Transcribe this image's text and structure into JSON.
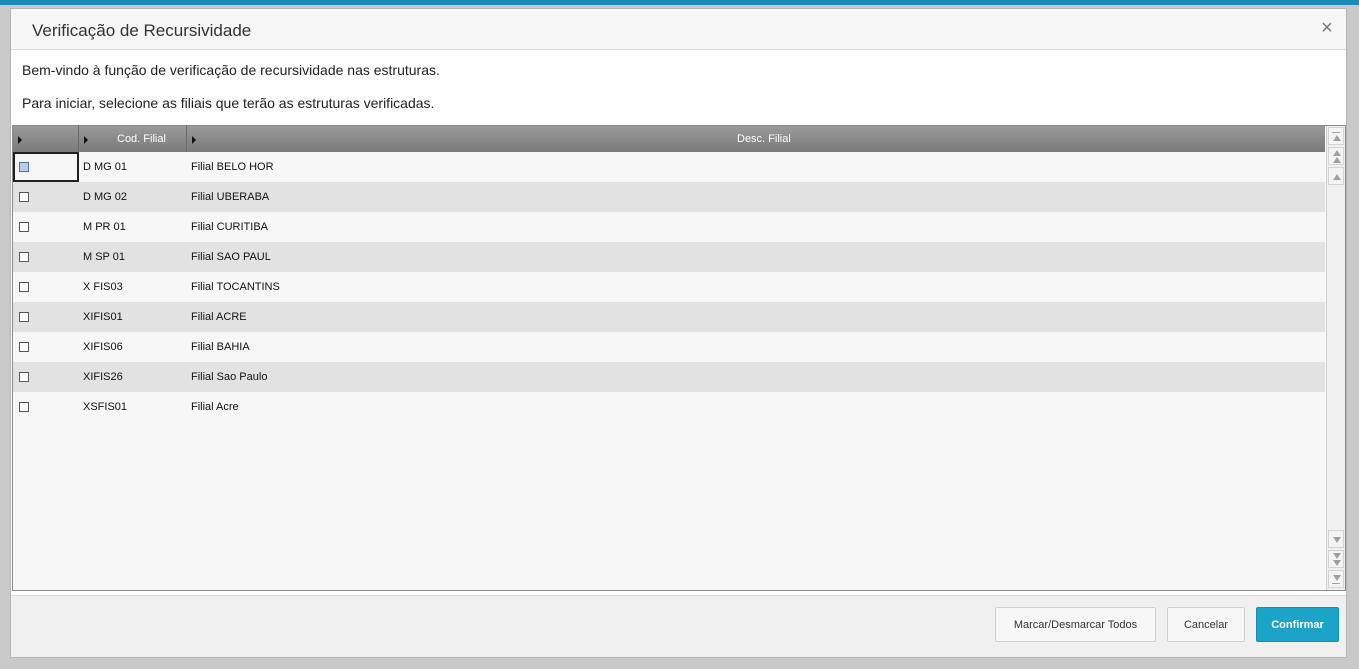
{
  "dialog": {
    "title": "Verificação de Recursividade",
    "close_symbol": "×",
    "message_line1": "Bem-vindo à função de verificação de recursividade nas estruturas.",
    "message_line2": "Para iniciar, selecione as filiais que terão as estruturas verificadas."
  },
  "grid": {
    "columns": [
      "",
      "Cod. Filial",
      "Desc. Filial"
    ],
    "rows": [
      {
        "checked": false,
        "code": "D MG 01",
        "desc": "Filial BELO HOR"
      },
      {
        "checked": false,
        "code": "D MG 02",
        "desc": "Filial UBERABA"
      },
      {
        "checked": false,
        "code": "M PR 01",
        "desc": "Filial CURITIBA"
      },
      {
        "checked": false,
        "code": "M SP 01",
        "desc": "Filial SAO PAUL"
      },
      {
        "checked": false,
        "code": "X FIS03",
        "desc": "Filial TOCANTINS"
      },
      {
        "checked": false,
        "code": "XIFIS01",
        "desc": "Filial ACRE"
      },
      {
        "checked": false,
        "code": "XIFIS06",
        "desc": "Filial BAHIA"
      },
      {
        "checked": false,
        "code": "XIFIS26",
        "desc": "Filial Sao Paulo"
      },
      {
        "checked": false,
        "code": "XSFIS01",
        "desc": "Filial Acre"
      }
    ]
  },
  "buttons": {
    "toggle_all": "Marcar/Desmarcar Todos",
    "cancel": "Cancelar",
    "confirm": "Confirmar"
  },
  "colors": {
    "accent": "#1ca3c8",
    "top_bar": "#1b8db9",
    "header_bg": "#8a8a8a"
  },
  "icons": {
    "close": "close-icon",
    "sort": "column-arrow-icon",
    "scroll_top": "scroll-top-icon",
    "scroll_page_up": "scroll-page-up-icon",
    "scroll_up": "scroll-up-icon",
    "scroll_down": "scroll-down-icon",
    "scroll_page_down": "scroll-page-down-icon",
    "scroll_bottom": "scroll-bottom-icon"
  }
}
